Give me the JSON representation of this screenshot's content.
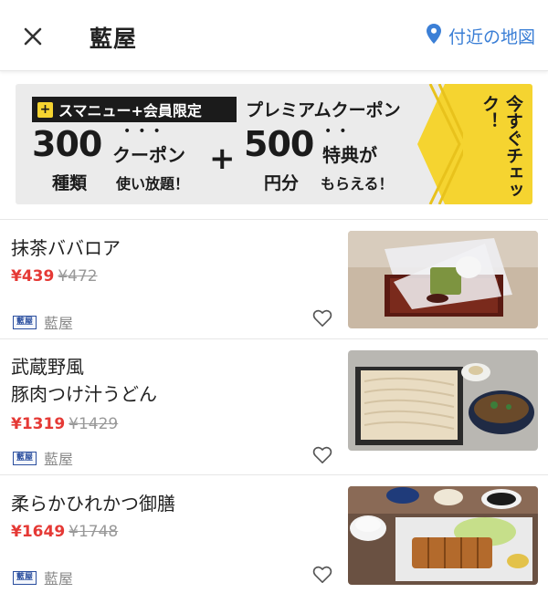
{
  "header": {
    "title": "藍屋",
    "map_label": "付近の地図",
    "accent": "#3b7fd6"
  },
  "banner": {
    "badge": "スマニュー+会員限定",
    "badge_plus": "+",
    "premium": "プレミアムクーポン",
    "num1": "300",
    "unit1": "種類",
    "coupon": "クーポン",
    "coupon_sub": "使い放題！",
    "plus": "+",
    "num2": "500",
    "unit2": "円分",
    "tokuten": "特典が",
    "tokuten_sub": "もらえる！",
    "dots1": "•••",
    "dots2": "••",
    "cta": "今すぐチェック！",
    "colors": {
      "yellow": "#f5d430",
      "gray": "#ebebeb"
    }
  },
  "items": [
    {
      "name_lines": [
        "抹茶ババロア"
      ],
      "price": "¥439",
      "old_price": "¥472",
      "shop": "藍屋",
      "shop_logo": "藍屋",
      "image": "matcha-bavarois-photo"
    },
    {
      "name_lines": [
        "武蔵野風",
        "豚肉つけ汁うどん"
      ],
      "price": "¥1319",
      "old_price": "¥1429",
      "shop": "藍屋",
      "shop_logo": "藍屋",
      "image": "udon-photo"
    },
    {
      "name_lines": [
        "柔らかひれかつ御膳"
      ],
      "price": "¥1649",
      "old_price": "¥1748",
      "shop": "藍屋",
      "shop_logo": "藍屋",
      "image": "katsu-gozen-photo"
    }
  ],
  "colors": {
    "price": "#e53935",
    "old_price": "#999999"
  }
}
